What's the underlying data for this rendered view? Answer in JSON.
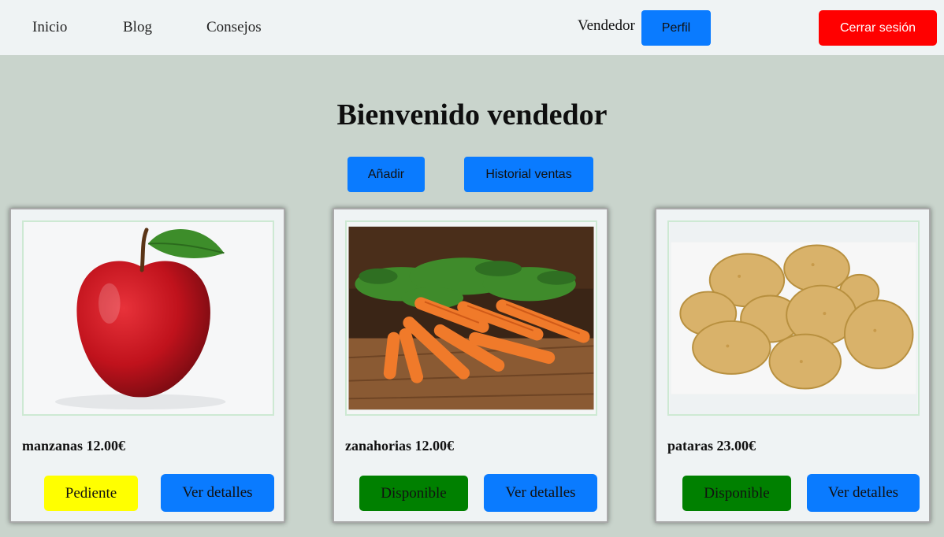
{
  "nav": {
    "links": [
      "Inicio",
      "Blog",
      "Consejos"
    ],
    "role": "Vendedor",
    "profile_label": "Perfil",
    "logout_label": "Cerrar sesión"
  },
  "main": {
    "title": "Bienvenido vendedor",
    "add_label": "Añadir",
    "history_label": "Historial ventas"
  },
  "products": [
    {
      "name": "manzanas 12.00€",
      "status": "Pediente",
      "status_color": "#ffff00",
      "detail_label": "Ver detalles",
      "image": "apple-photo"
    },
    {
      "name": "zanahorias 12.00€",
      "status": "Disponible",
      "status_color": "#008000",
      "detail_label": "Ver detalles",
      "image": "carrots-photo"
    },
    {
      "name": "pataras 23.00€",
      "status": "Disponible",
      "status_color": "#008000",
      "detail_label": "Ver detalles",
      "image": "potatoes-photo"
    }
  ],
  "colors": {
    "primary": "#0a7bff",
    "danger": "#ff0000",
    "background": "#c9d4cc",
    "navbar": "#eff3f4"
  }
}
